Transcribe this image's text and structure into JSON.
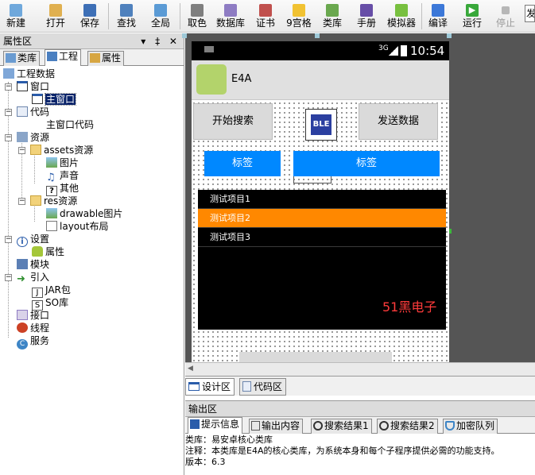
{
  "toolbar": {
    "buttons": [
      {
        "label": "新建",
        "icon": "new-file-icon",
        "color": "#6fa8dc"
      },
      {
        "label": "打开",
        "icon": "open-folder-icon",
        "color": "#e0b050"
      },
      {
        "label": "保存",
        "icon": "save-disk-icon",
        "color": "#3d6fb6"
      },
      {
        "label": "查找",
        "icon": "find-magnifier-icon",
        "color": "#4f81bd"
      },
      {
        "label": "全局",
        "icon": "global-search-icon",
        "color": "#5b9bd5"
      },
      {
        "label": "取色",
        "icon": "color-picker-icon",
        "color": "#7f7f7f"
      },
      {
        "label": "数据库",
        "icon": "database-icon",
        "color": "#8e7cc3"
      },
      {
        "label": "证书",
        "icon": "certificate-icon",
        "color": "#c0504d"
      },
      {
        "label": "9宫格",
        "icon": "nine-grid-icon",
        "color": "#f1c232"
      },
      {
        "label": "类库",
        "icon": "library-icon",
        "color": "#6aa84f"
      },
      {
        "label": "手册",
        "icon": "manual-icon",
        "color": "#674ea7"
      },
      {
        "label": "模拟器",
        "icon": "android-emulator-icon",
        "color": "#78c03f"
      },
      {
        "label": "编译",
        "icon": "compile-icon",
        "color": "#3c78d8"
      },
      {
        "label": "运行",
        "icon": "run-play-icon",
        "color": "#38a83a"
      },
      {
        "label": "停止",
        "icon": "stop-icon",
        "color": "#b7b7b7"
      }
    ],
    "edge_text": "发"
  },
  "left_panel": {
    "title": "属性区",
    "title_controls": "▾ ‡ ✕",
    "tabs": [
      "类库",
      "工程",
      "属性"
    ],
    "tree": [
      {
        "label": "工程数据",
        "icon": "project-icon"
      },
      {
        "label": "窗口",
        "icon": "window-icon"
      },
      {
        "label": "主窗口",
        "icon": "window-icon"
      },
      {
        "label": "代码",
        "icon": "code-file-icon"
      },
      {
        "label": "主窗口代码",
        "icon": ""
      },
      {
        "label": "资源",
        "icon": "resource-icon"
      },
      {
        "label": "assets资源",
        "icon": "folder-icon"
      },
      {
        "label": "图片",
        "icon": "image-icon"
      },
      {
        "label": "声音",
        "icon": "music-note-icon"
      },
      {
        "label": "其他",
        "icon": "question-icon"
      },
      {
        "label": "res资源",
        "icon": "folder-icon"
      },
      {
        "label": "drawable图片",
        "icon": "image-icon"
      },
      {
        "label": "layout布局",
        "icon": "layout-file-icon"
      },
      {
        "label": "设置",
        "icon": "info-icon"
      },
      {
        "label": "属性",
        "icon": "android-icon"
      },
      {
        "label": "模块",
        "icon": "module-icon"
      },
      {
        "label": "引入",
        "icon": "import-arrow-icon"
      },
      {
        "label": "JAR包",
        "icon": "jar-icon"
      },
      {
        "label": "SO库",
        "icon": "so-library-icon"
      },
      {
        "label": "接口",
        "icon": "interface-icon"
      },
      {
        "label": "线程",
        "icon": "thread-icon"
      },
      {
        "label": "服务",
        "icon": "service-icon"
      }
    ]
  },
  "phone": {
    "status_signal": "3G",
    "time": "10:54",
    "app_title": "E4A",
    "buttons": {
      "start_search": "开始搜索",
      "send_data": "发送数据",
      "ble": "BLE"
    },
    "labels": {
      "left": "标签",
      "right": "标签"
    },
    "list_items": [
      "测试项目1",
      "测试项目2",
      "测试项目3"
    ],
    "watermark": "51黑电子",
    "accent_color": "#0088ff",
    "highlight_color": "#ff8800"
  },
  "design_tabs": [
    "设计区",
    "代码区"
  ],
  "output": {
    "title": "输出区",
    "tabs": [
      "提示信息",
      "输出内容",
      "搜索结果1",
      "搜索结果2",
      "加密队列"
    ],
    "lines": [
      "类库：易安卓核心类库",
      "注释：本类库是E4A的核心类库，为系统本身和每个子程序提供必需的功能支持。",
      "版本：6.3"
    ]
  }
}
